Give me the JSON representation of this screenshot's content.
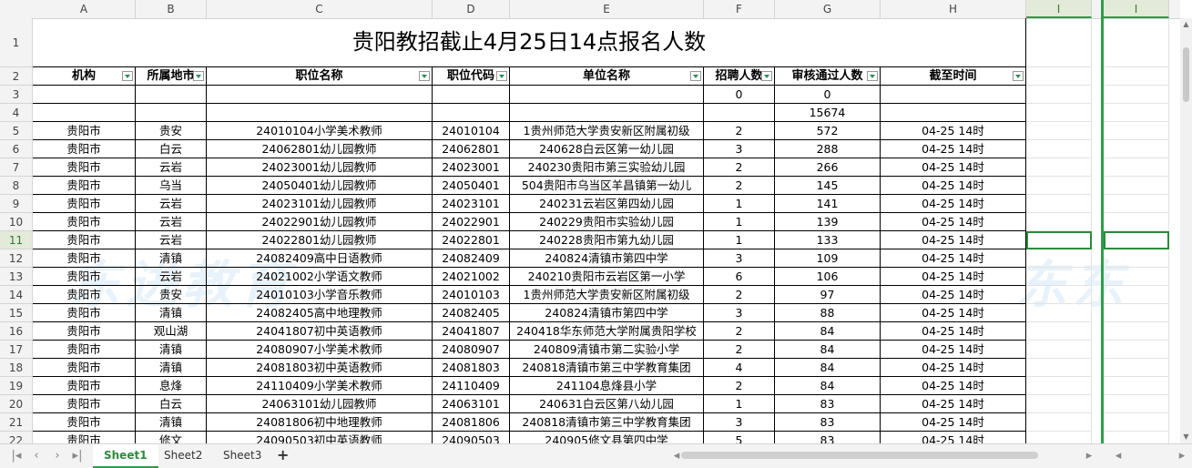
{
  "columns": [
    "A",
    "B",
    "C",
    "D",
    "E",
    "F",
    "G",
    "H",
    "I",
    "I"
  ],
  "rows": [
    "1",
    "2",
    "3",
    "4",
    "5",
    "6",
    "7",
    "8",
    "9",
    "10",
    "11",
    "12",
    "13",
    "14",
    "15",
    "16",
    "17",
    "18",
    "19",
    "20",
    "21",
    "22"
  ],
  "title": "贵阳教招截止4月25日14点报名人数",
  "headers": [
    "机构",
    "所属地市",
    "职位名称",
    "职位代码",
    "单位名称",
    "招聘人数",
    "审核通过人数",
    "截至时间"
  ],
  "row3": {
    "f": "0",
    "g": "0"
  },
  "row4": {
    "g": "15674"
  },
  "data": [
    [
      "贵阳市",
      "贵安",
      "24010104小学美术教师",
      "24010104",
      "1贵州师范大学贵安新区附属初级",
      "2",
      "572",
      "04-25 14时"
    ],
    [
      "贵阳市",
      "白云",
      "24062801幼儿园教师",
      "24062801",
      "240628白云区第一幼儿园",
      "3",
      "288",
      "04-25 14时"
    ],
    [
      "贵阳市",
      "云岩",
      "24023001幼儿园教师",
      "24023001",
      "240230贵阳市第三实验幼儿园",
      "2",
      "266",
      "04-25 14时"
    ],
    [
      "贵阳市",
      "乌当",
      "24050401幼儿园教师",
      "24050401",
      "504贵阳市乌当区羊昌镇第一幼儿",
      "2",
      "145",
      "04-25 14时"
    ],
    [
      "贵阳市",
      "云岩",
      "24023101幼儿园教师",
      "24023101",
      "240231云岩区第四幼儿园",
      "1",
      "141",
      "04-25 14时"
    ],
    [
      "贵阳市",
      "云岩",
      "24022901幼儿园教师",
      "24022901",
      "240229贵阳市实验幼儿园",
      "1",
      "139",
      "04-25 14时"
    ],
    [
      "贵阳市",
      "云岩",
      "24022801幼儿园教师",
      "24022801",
      "240228贵阳市第九幼儿园",
      "1",
      "133",
      "04-25 14时"
    ],
    [
      "贵阳市",
      "清镇",
      "24082409高中日语教师",
      "24082409",
      "240824清镇市第四中学",
      "3",
      "109",
      "04-25 14时"
    ],
    [
      "贵阳市",
      "云岩",
      "24021002小学语文教师",
      "24021002",
      "240210贵阳市云岩区第一小学",
      "6",
      "106",
      "04-25 14时"
    ],
    [
      "贵阳市",
      "贵安",
      "24010103小学音乐教师",
      "24010103",
      "1贵州师范大学贵安新区附属初级",
      "2",
      "97",
      "04-25 14时"
    ],
    [
      "贵阳市",
      "清镇",
      "24082405高中地理教师",
      "24082405",
      "240824清镇市第四中学",
      "3",
      "88",
      "04-25 14时"
    ],
    [
      "贵阳市",
      "观山湖",
      "24041807初中英语教师",
      "24041807",
      "240418华东师范大学附属贵阳学校",
      "2",
      "84",
      "04-25 14时"
    ],
    [
      "贵阳市",
      "清镇",
      "24080907小学美术教师",
      "24080907",
      "240809清镇市第二实验小学",
      "2",
      "84",
      "04-25 14时"
    ],
    [
      "贵阳市",
      "清镇",
      "24081803初中英语教师",
      "24081803",
      "240818清镇市第三中学教育集团",
      "4",
      "84",
      "04-25 14时"
    ],
    [
      "贵阳市",
      "息烽",
      "24110409小学美术教师",
      "24110409",
      "241104息烽县小学",
      "2",
      "84",
      "04-25 14时"
    ],
    [
      "贵阳市",
      "白云",
      "24063101幼儿园教师",
      "24063101",
      "240631白云区第八幼儿园",
      "1",
      "83",
      "04-25 14时"
    ],
    [
      "贵阳市",
      "清镇",
      "24081806初中地理教师",
      "24081806",
      "240818清镇市第三中学教育集团",
      "3",
      "83",
      "04-25 14时"
    ],
    [
      "贵阳市",
      "修文",
      "24090503初中英语教师",
      "24090503",
      "240905修文县第四中学",
      "5",
      "83",
      "04-25 14时"
    ]
  ],
  "watermark": [
    "东进教育",
    "东东"
  ],
  "tabs": [
    "Sheet1",
    "Sheet2",
    "Sheet3"
  ],
  "add_tab": "+",
  "colors": {
    "accent": "#2e9d4c",
    "header_bg": "#f3f3f3",
    "watermark": "#d6e9f7"
  }
}
